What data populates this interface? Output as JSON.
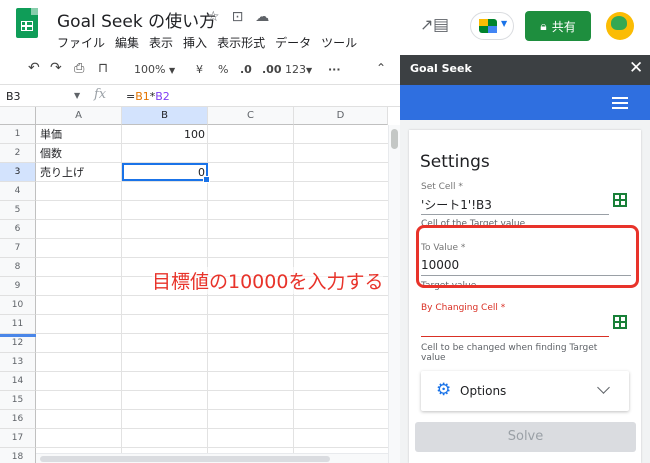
{
  "app": {
    "doc_title": "Goal Seek の使い方",
    "menu": [
      "ファイル",
      "編集",
      "表示",
      "挿入",
      "表示形式",
      "データ",
      "ツール"
    ],
    "share_label": "共有"
  },
  "toolbar": {
    "zoom": "100%",
    "currency": "¥",
    "percent": "%",
    "dec_decrease": ".0",
    "dec_increase": ".00",
    "format": "123",
    "more": "···"
  },
  "formula_bar": {
    "name_box": "B3",
    "fx": "fx",
    "formula_eq": "=",
    "formula_ref1": "B1",
    "formula_op": "*",
    "formula_ref2": "B2"
  },
  "sheet": {
    "columns": [
      "A",
      "B",
      "C",
      "D"
    ],
    "rows": [
      "1",
      "2",
      "3",
      "4",
      "5",
      "6",
      "7",
      "8",
      "9",
      "10",
      "11",
      "12",
      "13",
      "14",
      "15",
      "16",
      "17",
      "18"
    ],
    "cells": {
      "A1": "単価",
      "B1": "100",
      "A2": "個数",
      "A3": "売り上げ",
      "B3": "0"
    },
    "selected_cell": "B3"
  },
  "annotation": "目標値の10000を入力する",
  "panel": {
    "title": "Goal Seek",
    "settings_heading": "Settings",
    "set_cell_label": "Set Cell *",
    "set_cell_value": "'シート1'!B3",
    "set_cell_hint": "Cell of the Target value",
    "to_value_label": "To Value *",
    "to_value_value": "10000",
    "to_value_hint": "Target value",
    "changing_cell_label": "By Changing Cell *",
    "changing_cell_value": "",
    "changing_cell_hint": "Cell to be changed when finding Target value",
    "options_label": "Options",
    "solve_label": "Solve"
  },
  "colors": {
    "accent_blue": "#2f6fe0",
    "share_green": "#1e8e3e",
    "annotation_red": "#e8332a"
  }
}
